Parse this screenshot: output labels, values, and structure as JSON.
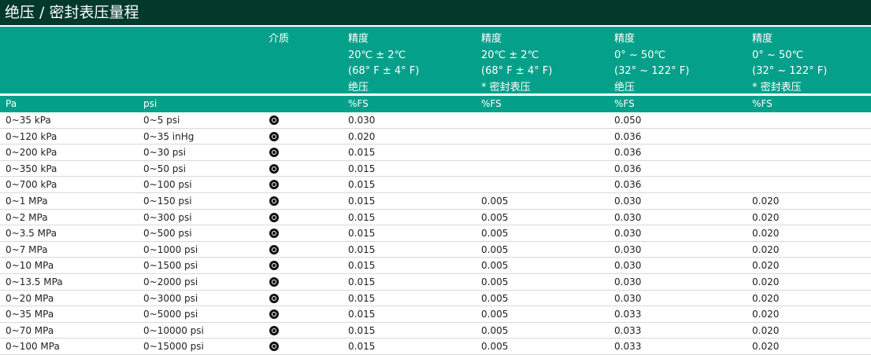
{
  "title": "绝压 / 密封表压量程",
  "header": {
    "medium": "介质",
    "columns": [
      {
        "l1": "精度",
        "l2": "20℃ ± 2℃",
        "l3": "(68° F ± 4° F)",
        "l4": "绝压"
      },
      {
        "l1": "精度",
        "l2": "20℃ ± 2℃",
        "l3": "(68° F ± 4° F)",
        "l4": "* 密封表压"
      },
      {
        "l1": "精度",
        "l2": "0° ~ 50℃",
        "l3": "(32° ~ 122° F)",
        "l4": "绝压"
      },
      {
        "l1": "精度",
        "l2": "0° ~ 50℃",
        "l3": "(32° ~ 122° F)",
        "l4": "* 密封表压"
      }
    ]
  },
  "units": {
    "pa": "Pa",
    "psi": "psi",
    "c3": "%FS",
    "c4": "%FS",
    "c5": "%FS",
    "c6": "%FS"
  },
  "rows": [
    {
      "pa": "0~35 kPa",
      "psi": "0~5 psi",
      "a": "0.030",
      "b": "",
      "c": "0.050",
      "d": ""
    },
    {
      "pa": "0~120 kPa",
      "psi": "0~35 inHg",
      "a": "0.020",
      "b": "",
      "c": "0.036",
      "d": ""
    },
    {
      "pa": "0~200 kPa",
      "psi": "0~30 psi",
      "a": "0.015",
      "b": "",
      "c": "0.036",
      "d": ""
    },
    {
      "pa": "0~350 kPa",
      "psi": "0~50 psi",
      "a": "0.015",
      "b": "",
      "c": "0.036",
      "d": ""
    },
    {
      "pa": "0~700 kPa",
      "psi": "0~100 psi",
      "a": "0.015",
      "b": "",
      "c": "0.036",
      "d": ""
    },
    {
      "pa": "0~1 MPa",
      "psi": "0~150 psi",
      "a": "0.015",
      "b": "0.005",
      "c": "0.030",
      "d": "0.020"
    },
    {
      "pa": "0~2 MPa",
      "psi": "0~300 psi",
      "a": "0.015",
      "b": "0.005",
      "c": "0.030",
      "d": "0.020"
    },
    {
      "pa": "0~3.5 MPa",
      "psi": "0~500 psi",
      "a": "0.015",
      "b": "0.005",
      "c": "0.030",
      "d": "0.020"
    },
    {
      "pa": "0~7 MPa",
      "psi": "0~1000 psi",
      "a": "0.015",
      "b": "0.005",
      "c": "0.030",
      "d": "0.020"
    },
    {
      "pa": "0~10 MPa",
      "psi": "0~1500 psi",
      "a": "0.015",
      "b": "0.005",
      "c": "0.030",
      "d": "0.020"
    },
    {
      "pa": "0~13.5 MPa",
      "psi": "0~2000 psi",
      "a": "0.015",
      "b": "0.005",
      "c": "0.030",
      "d": "0.020"
    },
    {
      "pa": "0~20 MPa",
      "psi": "0~3000 psi",
      "a": "0.015",
      "b": "0.005",
      "c": "0.030",
      "d": "0.020"
    },
    {
      "pa": "0~35 MPa",
      "psi": "0~5000 psi",
      "a": "0.015",
      "b": "0.005",
      "c": "0.033",
      "d": "0.020"
    },
    {
      "pa": "0~70 MPa",
      "psi": "0~10000 psi",
      "a": "0.015",
      "b": "0.005",
      "c": "0.033",
      "d": "0.020"
    },
    {
      "pa": "0~100 MPa",
      "psi": "0~15000 psi",
      "a": "0.015",
      "b": "0.005",
      "c": "0.033",
      "d": "0.020"
    }
  ],
  "icons": {
    "medium": "gas-medium-icon"
  },
  "colors": {
    "title_bg": "#03392b",
    "header_bg": "#05a08a"
  }
}
